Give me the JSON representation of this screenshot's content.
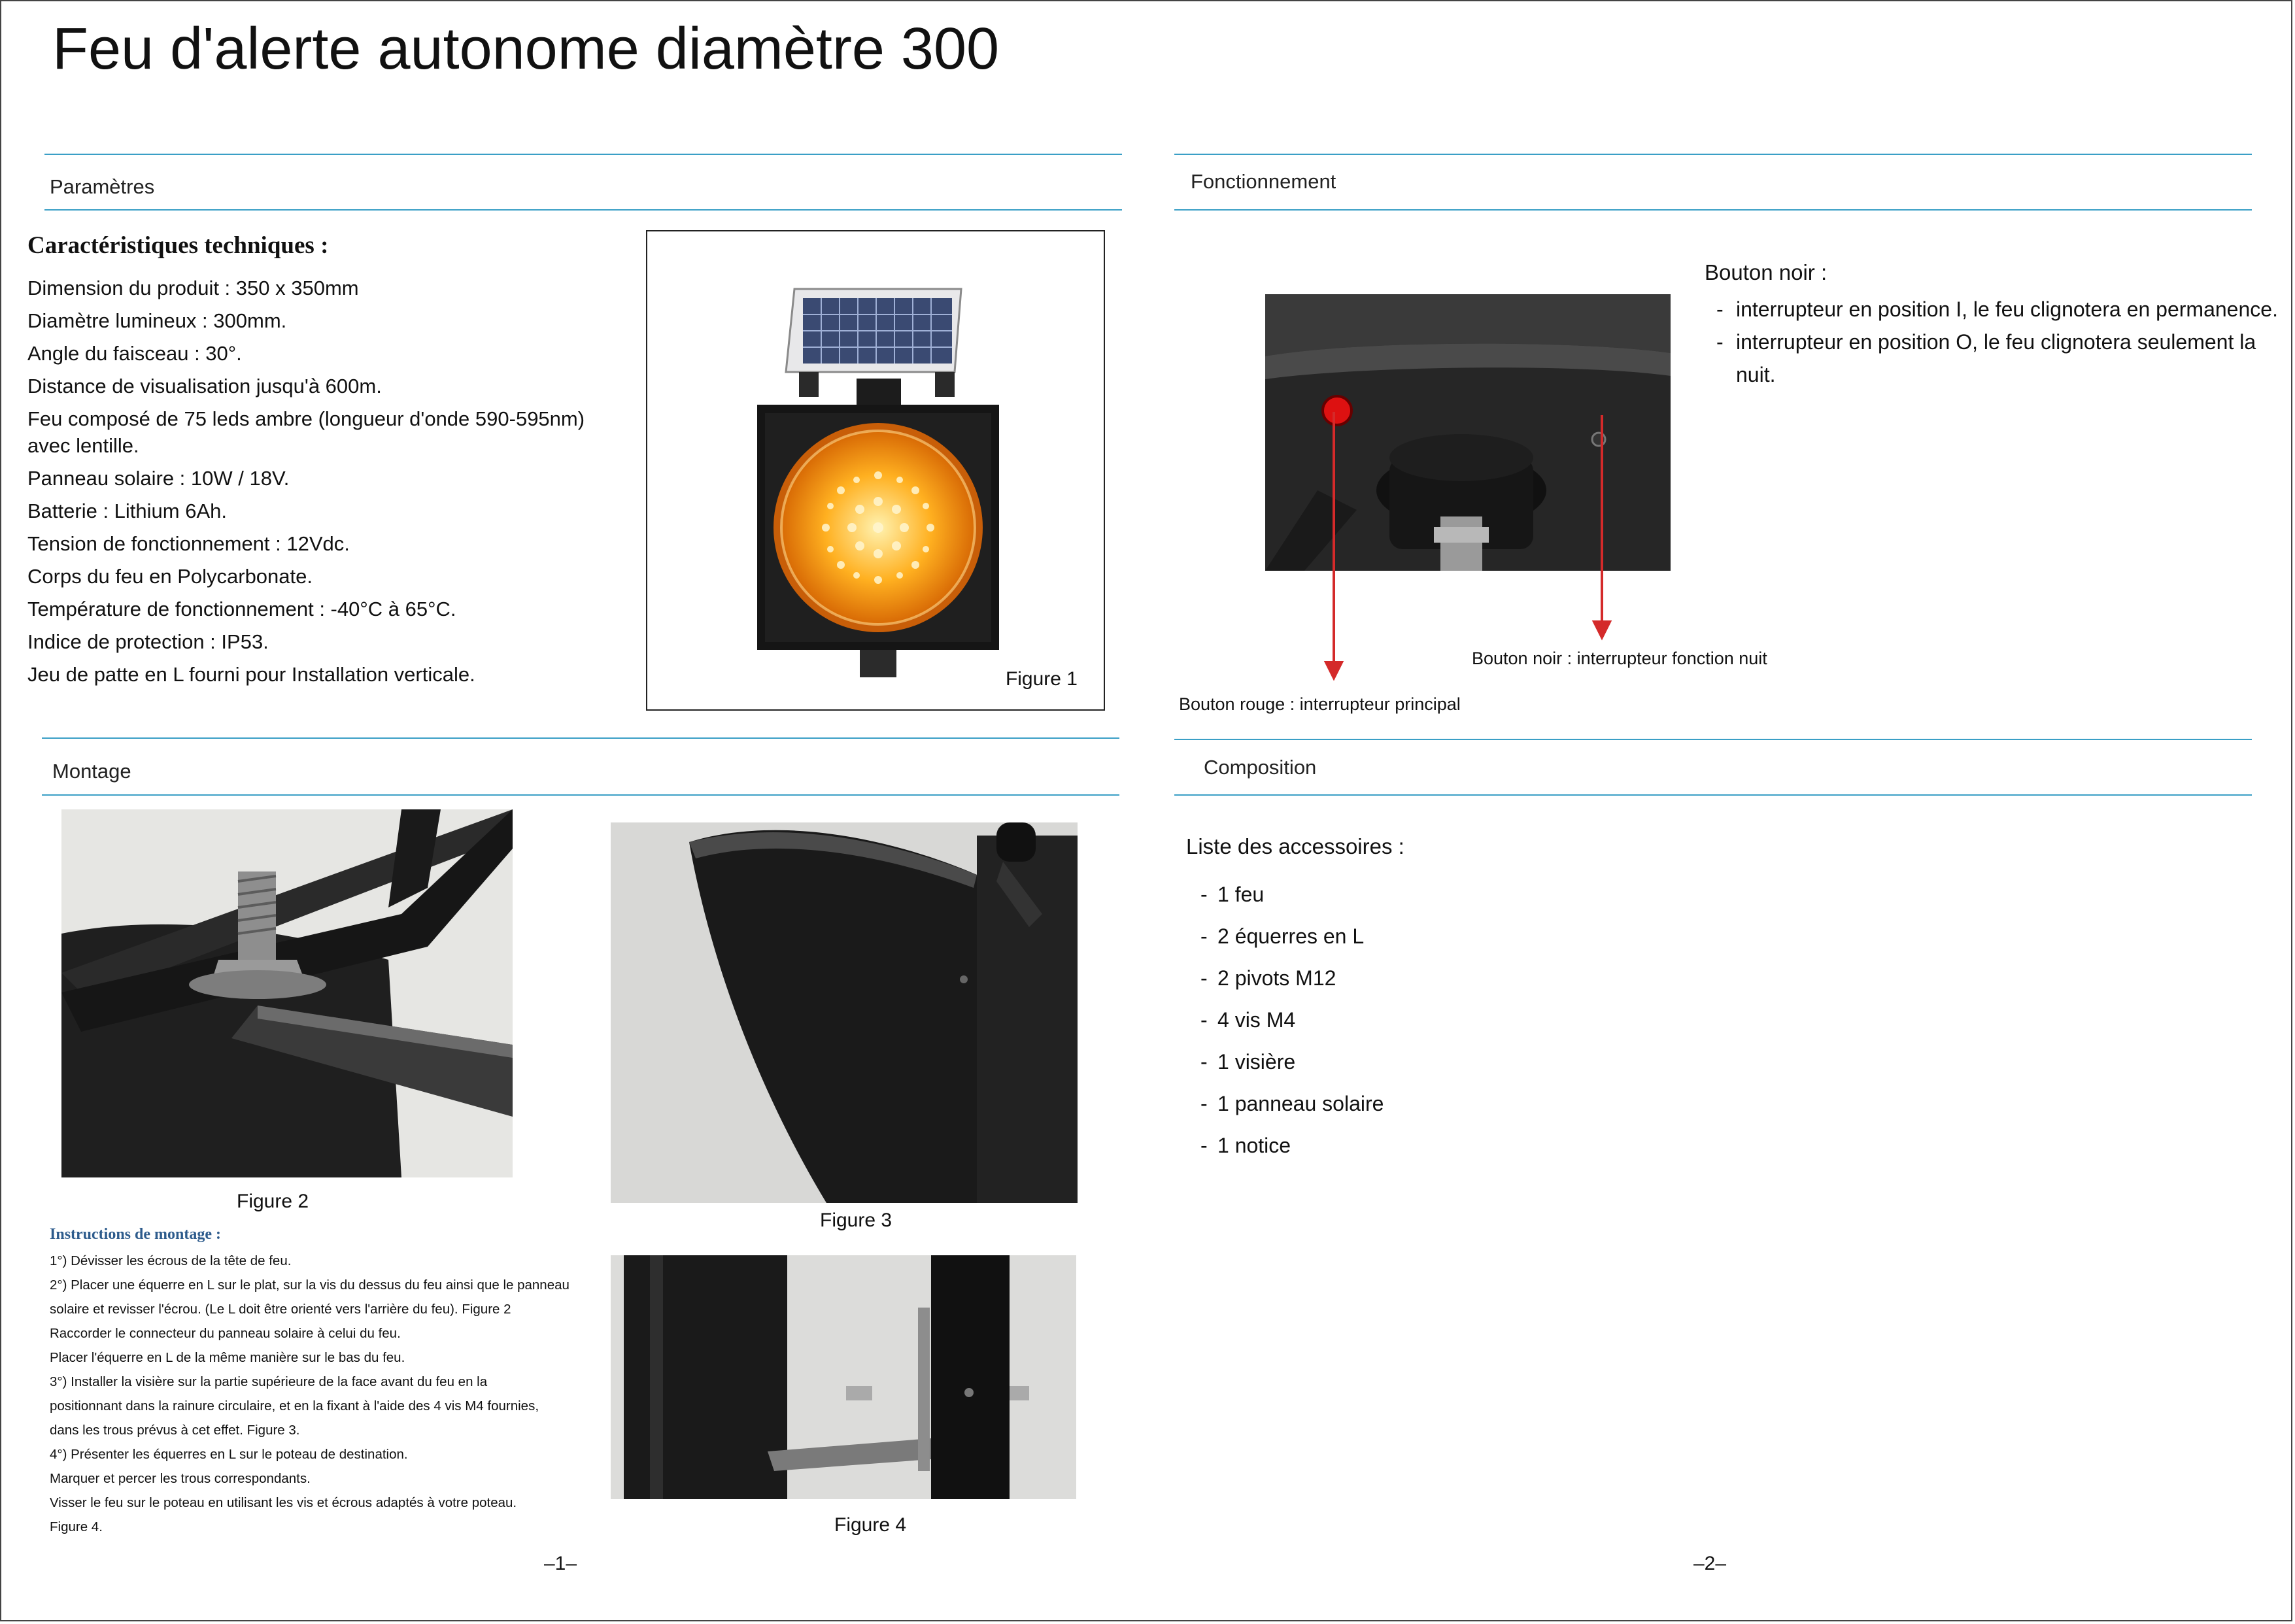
{
  "document": {
    "title": "Feu d'alerte autonome diamètre 300"
  },
  "sections": {
    "parametres": "Paramètres",
    "fonctionnement": "Fonctionnement",
    "montage": "Montage",
    "composition": "Composition"
  },
  "specs": {
    "heading": "Caractéristiques techniques :",
    "items": [
      "Dimension du produit : 350 x 350mm",
      "Diamètre lumineux : 300mm.",
      "Angle du faisceau : 30°.",
      "Distance de visualisation jusqu'à 600m.",
      "Feu composé de 75 leds ambre (longueur d'onde 590-595nm) avec lentille.",
      "Panneau solaire : 10W / 18V.",
      "Batterie : Lithium 6Ah.",
      "Tension de fonctionnement : 12Vdc.",
      "Corps du feu en Polycarbonate.",
      "Température de fonctionnement : -40°C à 65°C.",
      "Indice de protection : IP53.",
      "Jeu de patte en L fourni pour Installation verticale."
    ]
  },
  "figures": {
    "fig1": "Figure 1",
    "fig2": "Figure 2",
    "fig3": "Figure 3",
    "fig4": "Figure 4"
  },
  "fonctionnement": {
    "black_button_title": "Bouton noir :",
    "black_button_items": [
      "interrupteur en position I, le feu clignotera en permanence.",
      "interrupteur en position O, le feu clignotera seulement la nuit."
    ],
    "label_black": "Bouton noir : interrupteur fonction nuit",
    "label_red": "Bouton rouge : interrupteur principal"
  },
  "instructions": {
    "title": "Instructions de montage :",
    "lines": [
      "1°) Dévisser les écrous de la tête de feu.",
      "2°)  Placer une équerre en L sur le plat, sur la vis du dessus du feu ainsi que le panneau",
      "solaire et revisser l'écrou. (Le L  doit être orienté vers l'arrière du feu). Figure 2",
      "Raccorder le connecteur du panneau solaire à celui du feu.",
      "Placer l'équerre en L de la même manière sur le bas du feu.",
      "3°) Installer la visière sur la partie supérieure de la face avant du feu en la",
      "positionnant dans la rainure circulaire, et en la fixant à l'aide des 4 vis M4 fournies,",
      "dans les trous prévus à cet effet. Figure 3.",
      "4°) Présenter les équerres en L sur le poteau de destination.",
      "Marquer et percer  les trous correspondants.",
      "Visser le feu sur le poteau en utilisant les vis et écrous adaptés à votre poteau.",
      " Figure 4."
    ]
  },
  "composition": {
    "title": "Liste des accessoires :",
    "items": [
      "1 feu",
      "2 équerres en L",
      "2 pivots M12",
      "4 vis M4",
      "1 visière",
      "1 panneau solaire",
      "1 notice"
    ]
  },
  "pages": {
    "left": "–1–",
    "right": "–2–"
  },
  "colors": {
    "rule": "#3a9fc6",
    "arrow": "#d42a2a",
    "instr_title": "#2d5b8c",
    "amber": "#ffb020"
  }
}
